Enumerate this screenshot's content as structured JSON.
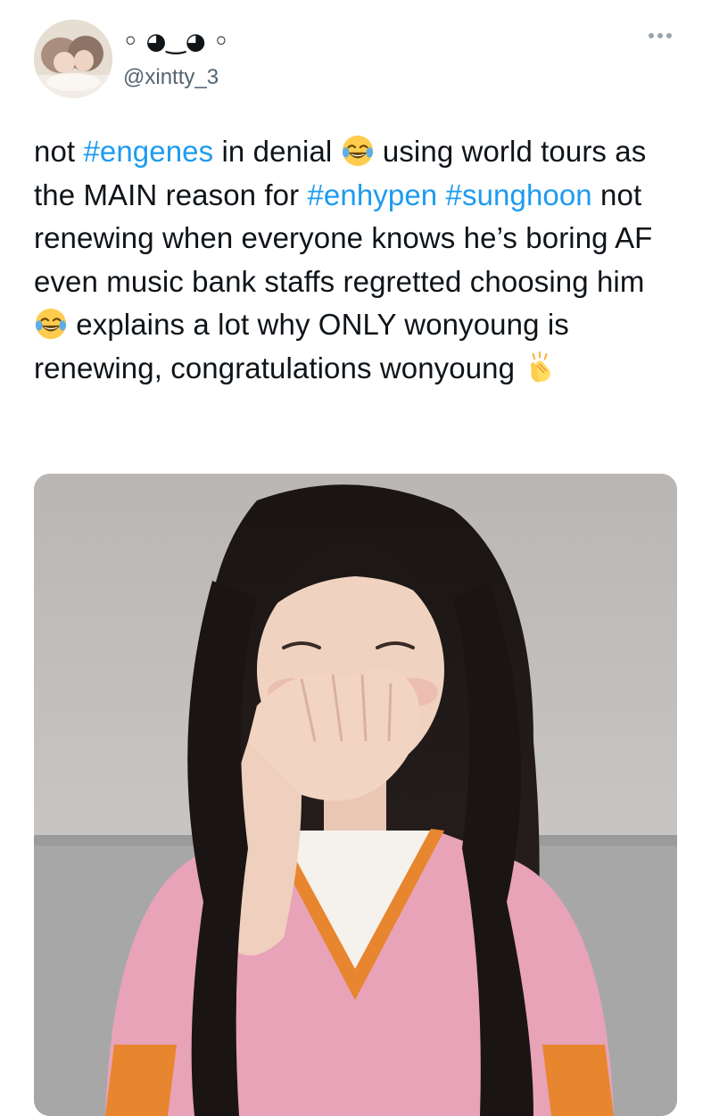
{
  "tweet": {
    "author": {
      "display_name": "◦ ◕‿◕ ◦",
      "handle": "@xintty_3"
    },
    "text_segments": {
      "s1": "not ",
      "h1": "#engenes",
      "s2": " in denial ",
      "s3": " using world tours as the MAIN reason for ",
      "h2": "#enhypen",
      "s4": " ",
      "h3": "#sunghoon",
      "s5": " not renewing when everyone knows he’s boring AF even music bank staffs regretted choosing him ",
      "s6": " explains a lot why ONLY wonyoung is renewing, congratulations wonyoung "
    },
    "emojis": [
      "face-with-tears-of-joy",
      "face-with-tears-of-joy",
      "clapping-hands"
    ],
    "media": {
      "type": "photo",
      "subject": "person-covering-mouth-laughing"
    }
  },
  "colors": {
    "hashtag": "#1d9bf0",
    "text": "#0f1419",
    "handle": "#536471"
  }
}
